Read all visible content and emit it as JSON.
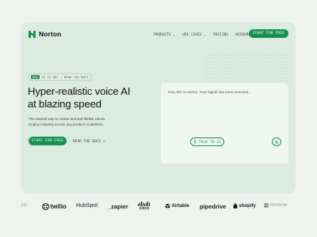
{
  "brand": {
    "name": "Norton",
    "color": "#17924f"
  },
  "nav": {
    "links": [
      "PRODUCTS ⌄",
      "USE CASES ⌄",
      "PRICING",
      "RESOURCES"
    ],
    "cta": "START FOR FREE"
  },
  "hero": {
    "badge_new": "NEW",
    "badge_text": "V3 IS OUT → READ THE DOCS",
    "headline_line1": "Hyper-realistic voice AI",
    "headline_line2": "at blazing speed",
    "sub_line1": "The easiest way to create and test lifelike voices.",
    "sub_line2": "Deploy instantly across any product or platform.",
    "cta": "START FOR FREE",
    "docs_link": "READ THE DOCS >"
  },
  "demo": {
    "message": "Hey, this is Norton. Your signal has been received...",
    "talk_label": "TALK TO AI",
    "talk_icon": "microphone-icon",
    "add_icon": "plus-icon"
  },
  "logos": [
    "AM",
    "twilio",
    "HubSpot",
    "_zapier",
    "cisco",
    "Airtable",
    "pipedrive",
    "shopify",
    "INTERCOM"
  ]
}
